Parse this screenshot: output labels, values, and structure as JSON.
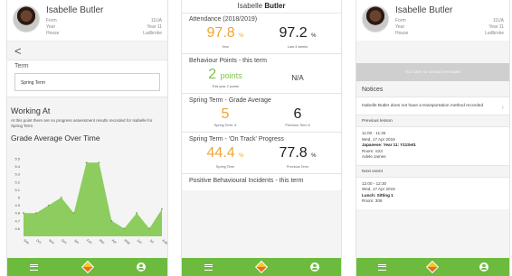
{
  "student": {
    "name": "Isabelle Butler",
    "name_first": "Isabelle",
    "name_last": "Butler"
  },
  "header": {
    "rows": [
      {
        "label": "Form",
        "value": "11UA"
      },
      {
        "label": "Year",
        "value": "Year 11"
      },
      {
        "label": "House",
        "value": "Ladbroke"
      }
    ]
  },
  "phone1": {
    "back_glyph": "<",
    "term_label": "Term",
    "term_value": "Spring Term",
    "working_at_title": "Working At",
    "working_at_text": "At this point there are no progress assessment results recorded for Isabelle for Spring Term.",
    "grade_avg_title": "Grade Average Over Time"
  },
  "chart_data": {
    "type": "area",
    "title": "Grade Average Over Time",
    "ylim": [
      4.5,
      5.5
    ],
    "y_ticks": [
      "5.5",
      "5.4",
      "5.3",
      "5.2",
      "5.1",
      "5",
      "4.9",
      "4.8",
      "4.7",
      "4.6"
    ],
    "x": [
      "Sep",
      "Oct",
      "Nov",
      "Dec",
      "Jan",
      "Feb",
      "Mar",
      "Apr",
      "May",
      "Jun",
      "Jul",
      "Aug"
    ],
    "values": [
      4.8,
      4.8,
      4.9,
      5.0,
      4.8,
      5.45,
      5.45,
      4.7,
      4.6,
      4.8,
      4.6,
      4.85
    ],
    "color": "#8dcc5e",
    "grid": false
  },
  "phone2": {
    "attendance": {
      "title": "Attendance (2018/2019)",
      "left_value": "97.8",
      "left_unit": "%",
      "left_sub": "Year",
      "right_value": "97.2",
      "right_unit": "%",
      "right_sub": "Last 4 weeks"
    },
    "behaviour": {
      "title": "Behaviour Points - this term",
      "left_value": "2",
      "left_unit": "points",
      "left_sub": "This year 2 points",
      "right_value": "N/A"
    },
    "grade_avg": {
      "title": "Spring Term - Grade Average",
      "left_value": "5",
      "left_sub": "Spring Term: 5",
      "right_value": "6",
      "right_sub": "Previous Term 6"
    },
    "on_track": {
      "title": "Spring Term - 'On Track' Progress",
      "left_value": "44.4",
      "left_unit": "%",
      "left_sub": "Spring Term",
      "right_value": "77.8",
      "right_unit": "%",
      "right_sub": "Previous Term"
    },
    "positive_title": "Positive Behavioural Incidents - this term"
  },
  "phone3": {
    "banner": "You have no unread messages",
    "notices_title": "Notices",
    "notice_text": "Isabelle Butler does not have a transportation method recorded",
    "prev_lesson_title": "Previous lesson",
    "prev_lesson": {
      "time": "11:00 - 11:45",
      "date": "Wed, 17 Apr 2019",
      "subject": "Japanese: Year 11: Y11Set1",
      "room": "Room: S23",
      "teacher": "Adele James"
    },
    "next_event_title": "Next event",
    "next_event": {
      "time": "12:00 - 12:30",
      "date": "Wed, 17 Apr 2019",
      "subject": "Lunch: Sitting 1",
      "room": "Room: 306"
    }
  },
  "nav": {
    "items": [
      "menu-icon",
      "home-logo-icon",
      "user-icon"
    ]
  },
  "colors": {
    "accent": "#6dbb3e",
    "green": "#7fc04b",
    "orange": "#f0a534"
  }
}
